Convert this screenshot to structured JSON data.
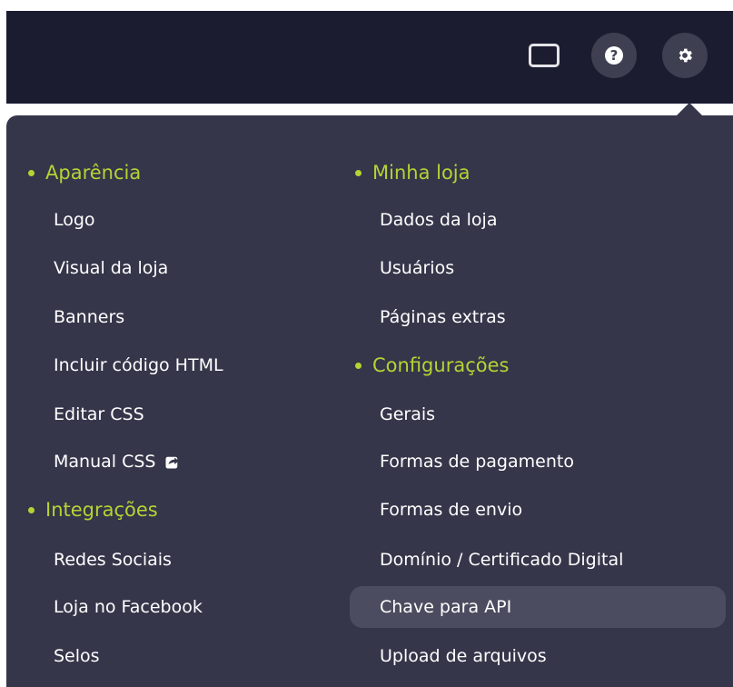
{
  "topbar": {
    "icons": [
      "monitor-icon",
      "help-icon",
      "gear-icon"
    ],
    "help_glyph": "?"
  },
  "menu": {
    "left": [
      {
        "type": "heading",
        "label": "Aparência"
      },
      {
        "type": "item",
        "label": "Logo"
      },
      {
        "type": "item",
        "label": "Visual da loja"
      },
      {
        "type": "item",
        "label": "Banners"
      },
      {
        "type": "item",
        "label": "Incluir código HTML"
      },
      {
        "type": "item",
        "label": "Editar CSS"
      },
      {
        "type": "item",
        "label": "Manual CSS",
        "icon": "external-link-icon"
      },
      {
        "type": "heading",
        "label": "Integrações"
      },
      {
        "type": "item",
        "label": "Redes Sociais"
      },
      {
        "type": "item",
        "label": "Loja no Facebook"
      },
      {
        "type": "item",
        "label": "Selos"
      }
    ],
    "right": [
      {
        "type": "heading",
        "label": "Minha loja"
      },
      {
        "type": "item",
        "label": "Dados da loja"
      },
      {
        "type": "item",
        "label": "Usuários"
      },
      {
        "type": "item",
        "label": "Páginas extras"
      },
      {
        "type": "heading",
        "label": "Configurações"
      },
      {
        "type": "item",
        "label": "Gerais"
      },
      {
        "type": "item",
        "label": "Formas de pagamento"
      },
      {
        "type": "item",
        "label": "Formas de envio"
      },
      {
        "type": "item",
        "label": "Domínio / Certificado Digital"
      },
      {
        "type": "item",
        "label": "Chave para API",
        "highlighted": true
      },
      {
        "type": "item",
        "label": "Upload de arquivos"
      }
    ]
  },
  "colors": {
    "topbar": "#1b1c30",
    "dropdown": "#35364a",
    "accent": "#b6d334",
    "highlight": "#4b4c5f"
  }
}
